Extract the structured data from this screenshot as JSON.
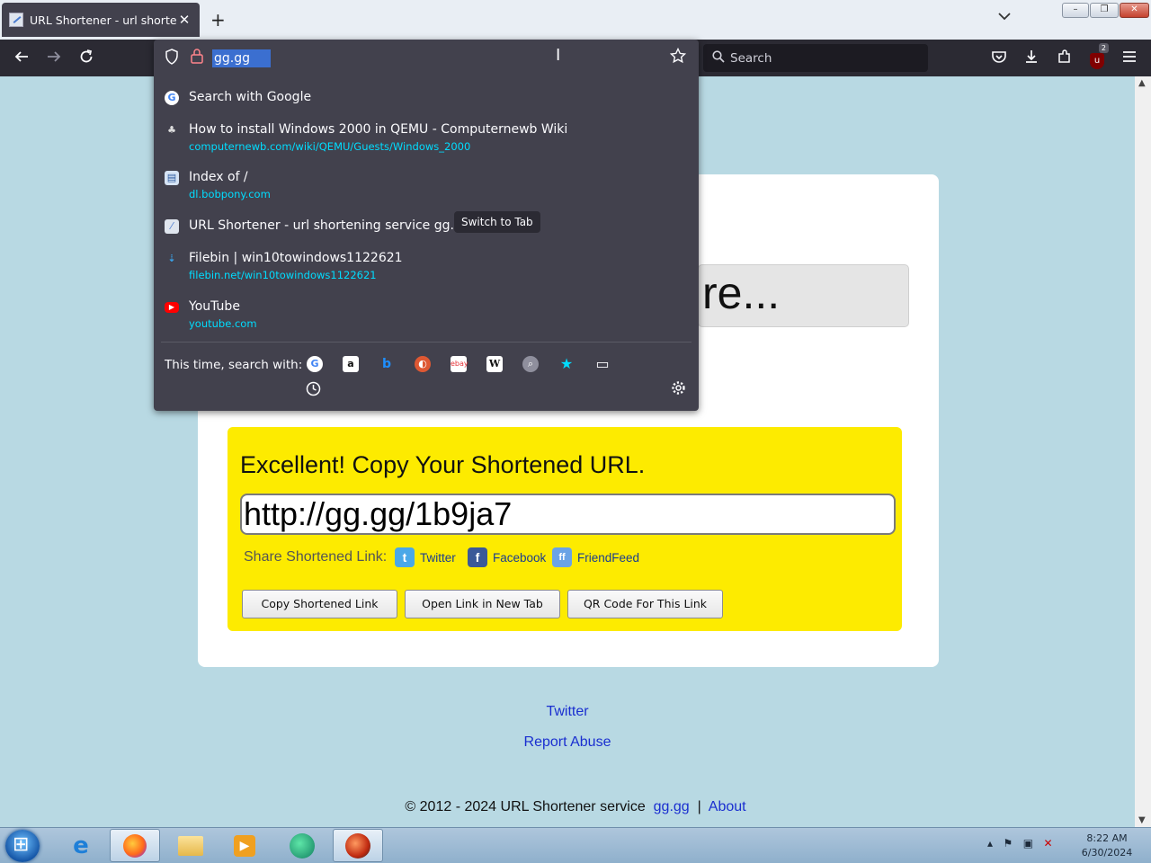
{
  "browser": {
    "tab_title": "URL Shortener - url shortening",
    "tab_close": "✕",
    "new_tab": "+",
    "tab_list": "⌵",
    "search_placeholder": "Search",
    "url_value": "gg.gg",
    "ublock_badge": "2"
  },
  "dropdown": {
    "suggestions": [
      {
        "title": "Search with Google",
        "url": "",
        "icon": "google-icon"
      },
      {
        "title": "How to install Windows 2000 in QEMU - Computernewb Wiki",
        "url": "computernewb.com/wiki/QEMU/Guests/Windows_2000",
        "icon": "wiki-icon"
      },
      {
        "title": "Index of /",
        "url": "dl.bobpony.com",
        "icon": "folder-icon"
      },
      {
        "title": "URL Shortener - url shortening service gg.gg",
        "url": "",
        "icon": "page-icon",
        "action": "Switch to Tab"
      },
      {
        "title": "Filebin | win10towindows1122621",
        "url": "filebin.net/win10towindows1122621",
        "icon": "download-icon"
      },
      {
        "title": "YouTube",
        "url": "youtube.com",
        "icon": "youtube-icon"
      }
    ],
    "this_time_label": "This time, search with:",
    "engines": [
      "google",
      "amazon",
      "bing",
      "duckduckgo",
      "ebay",
      "wikipedia",
      "search",
      "bookmarks",
      "tabs"
    ]
  },
  "page": {
    "big_text": "re...",
    "headline": "Excellent! Copy Your Shortened URL.",
    "short_url": "http://gg.gg/1b9ja7",
    "share_label": "Share Shortened Link:",
    "share": {
      "twitter": "Twitter",
      "facebook": "Facebook",
      "friendfeed": "FriendFeed"
    },
    "buttons": {
      "copy": "Copy Shortened Link",
      "open": "Open Link in New Tab",
      "qr": "QR Code For This Link"
    },
    "footer_twitter": "Twitter",
    "report_abuse": "Report Abuse",
    "copyright": "© 2012 - 2024 URL Shortener service",
    "footer_site": "gg.gg",
    "footer_sep": "|",
    "footer_about": "About"
  },
  "taskbar": {
    "time": "8:22 AM",
    "date": "6/30/2024"
  },
  "colors": {
    "urlbar_bg": "#42414d",
    "toolbar_bg": "#2b2a33",
    "page_bg": "#b8d9e3",
    "result_box": "#fdeb00",
    "link": "#1a2fd0",
    "url_suggestion": "#00ddff"
  }
}
